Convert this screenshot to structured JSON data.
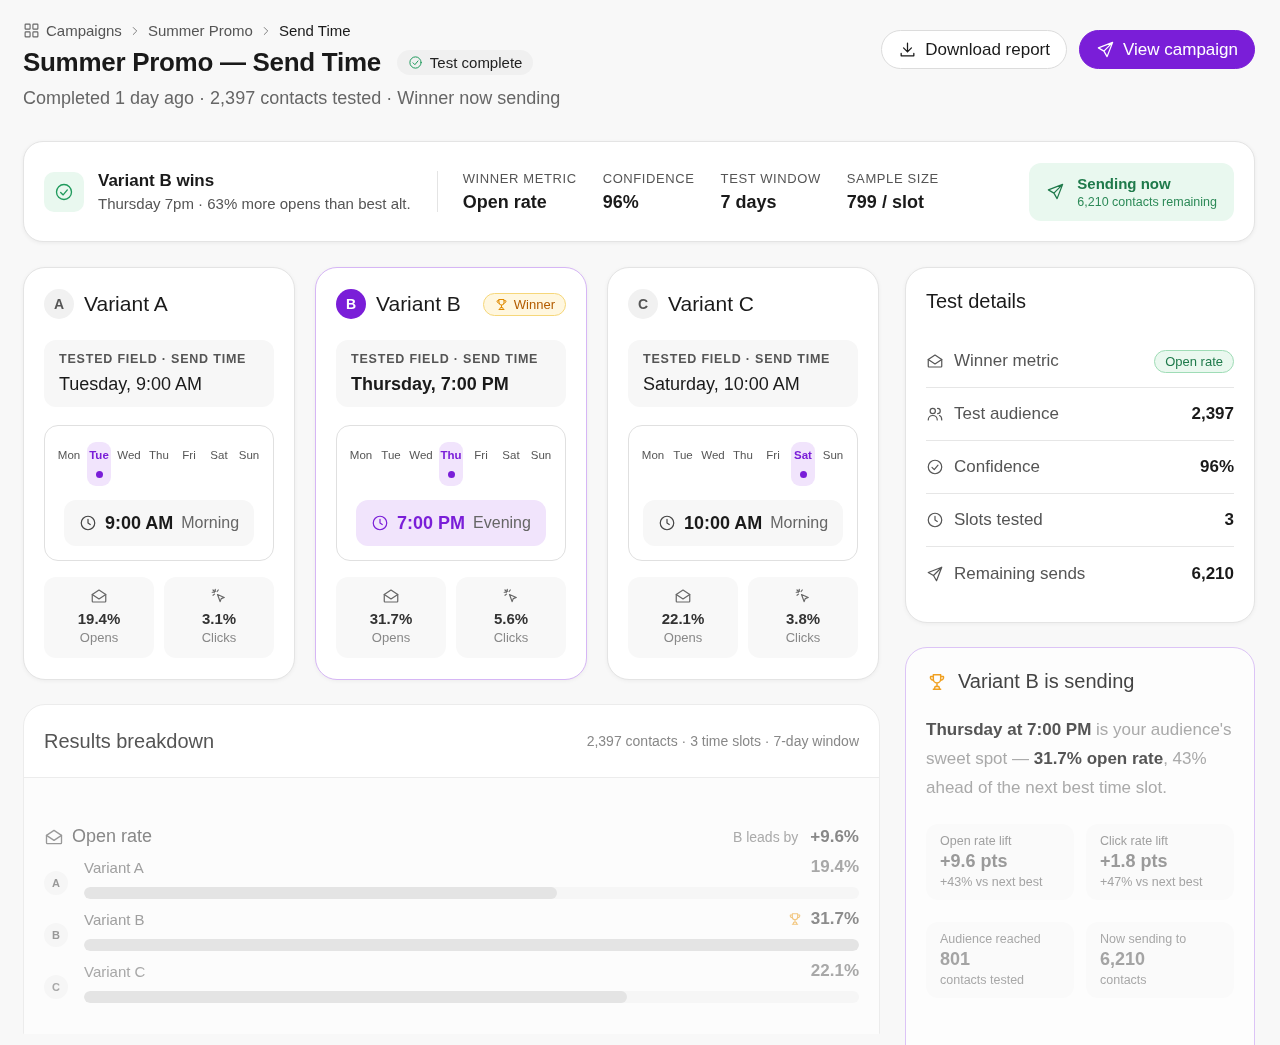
{
  "breadcrumb": [
    "Campaigns",
    "Summer Promo",
    "Send Time"
  ],
  "title": "Summer Promo — Send Time",
  "status_badge": "Test complete",
  "subtitle": "Completed 1 day ago · 2,397 contacts tested · Winner now sending",
  "actions": [
    {
      "label": "Download report",
      "kind": "secondary"
    },
    {
      "label": "View campaign",
      "kind": "primary"
    }
  ],
  "summary": {
    "title": "Variant B wins",
    "subtitle": "Thursday 7pm · 63% more opens than best alt.",
    "metrics": [
      {
        "label": "WINNER METRIC",
        "value": "Open rate"
      },
      {
        "label": "CONFIDENCE",
        "value": "96%"
      },
      {
        "label": "TEST WINDOW",
        "value": "7 days"
      },
      {
        "label": "SAMPLE SIZE",
        "value": "799 / slot"
      }
    ],
    "sending": {
      "title": "Sending now",
      "subtitle": "6,210 contacts remaining"
    }
  },
  "variants": [
    {
      "letter": "A",
      "name": "Variant A",
      "winner": false,
      "field_label": "TESTED FIELD · SEND TIME",
      "field_value": "Tuesday, 9:00 AM",
      "days": [
        {
          "label": "Mon",
          "selected": false
        },
        {
          "label": "Tue",
          "selected": true
        },
        {
          "label": "Wed",
          "selected": false
        },
        {
          "label": "Thu",
          "selected": false
        },
        {
          "label": "Fri",
          "selected": false
        },
        {
          "label": "Sat",
          "selected": false
        },
        {
          "label": "Sun",
          "selected": false
        }
      ],
      "time": "9:00 AM",
      "period": "Morning",
      "stats": [
        {
          "kind": "opens",
          "value": "19.4%",
          "label": "Opens"
        },
        {
          "kind": "clicks",
          "value": "3.1%",
          "label": "Clicks"
        }
      ]
    },
    {
      "letter": "B",
      "name": "Variant B",
      "winner": true,
      "badge": "Winner",
      "field_label": "TESTED FIELD · SEND TIME",
      "field_value": "Thursday, 7:00 PM",
      "days": [
        {
          "label": "Mon",
          "selected": false
        },
        {
          "label": "Tue",
          "selected": false
        },
        {
          "label": "Wed",
          "selected": false
        },
        {
          "label": "Thu",
          "selected": true
        },
        {
          "label": "Fri",
          "selected": false
        },
        {
          "label": "Sat",
          "selected": false
        },
        {
          "label": "Sun",
          "selected": false
        }
      ],
      "time": "7:00 PM",
      "period": "Evening",
      "stats": [
        {
          "kind": "opens",
          "value": "31.7%",
          "label": "Opens"
        },
        {
          "kind": "clicks",
          "value": "5.6%",
          "label": "Clicks"
        }
      ]
    },
    {
      "letter": "C",
      "name": "Variant C",
      "winner": false,
      "field_label": "TESTED FIELD · SEND TIME",
      "field_value": "Saturday, 10:00 AM",
      "days": [
        {
          "label": "Mon",
          "selected": false
        },
        {
          "label": "Tue",
          "selected": false
        },
        {
          "label": "Wed",
          "selected": false
        },
        {
          "label": "Thu",
          "selected": false
        },
        {
          "label": "Fri",
          "selected": false
        },
        {
          "label": "Sat",
          "selected": true
        },
        {
          "label": "Sun",
          "selected": false
        }
      ],
      "time": "10:00 AM",
      "period": "Morning",
      "stats": [
        {
          "kind": "opens",
          "value": "22.1%",
          "label": "Opens"
        },
        {
          "kind": "clicks",
          "value": "3.8%",
          "label": "Clicks"
        }
      ]
    }
  ],
  "results": {
    "title": "Results breakdown",
    "meta": "2,397 contacts · 3 time slots · 7-day window",
    "metric": {
      "label": "Open rate",
      "lead_label": "B leads by",
      "lead_value": "+9.6%"
    },
    "rows": [
      {
        "letter": "A",
        "name": "Variant A",
        "value": "19.4%",
        "level": 0.61,
        "winner": false
      },
      {
        "letter": "B",
        "name": "Variant B",
        "value": "31.7%",
        "level": 1.0,
        "winner": true
      },
      {
        "letter": "C",
        "name": "Variant C",
        "value": "22.1%",
        "level": 0.7,
        "winner": false
      }
    ]
  },
  "test_details": {
    "title": "Test details",
    "rows": [
      {
        "label": "Winner metric",
        "value": "Open rate",
        "kind": "pill"
      },
      {
        "label": "Test audience",
        "value": "2,397",
        "kind": "plain"
      },
      {
        "label": "Confidence",
        "value": "96%",
        "kind": "plain"
      },
      {
        "label": "Slots tested",
        "value": "3",
        "kind": "plain"
      },
      {
        "label": "Remaining sends",
        "value": "6,210",
        "kind": "plain"
      }
    ]
  },
  "sending_card": {
    "title": "Variant B is sending",
    "text": "**Thursday at 7:00 PM** is your audience's sweet spot — **31.7% open rate**, 43% ahead of the next best time slot.",
    "stats": [
      {
        "label": "Open rate lift",
        "value": "+9.6 pts",
        "note": "+43% vs next best"
      },
      {
        "label": "Click rate lift",
        "value": "+1.8 pts",
        "note": "+47% vs next best"
      },
      {
        "label": "Audience reached",
        "value": "801",
        "note": "contacts tested"
      },
      {
        "label": "Now sending to",
        "value": "6,210",
        "note": "contacts"
      }
    ]
  }
}
